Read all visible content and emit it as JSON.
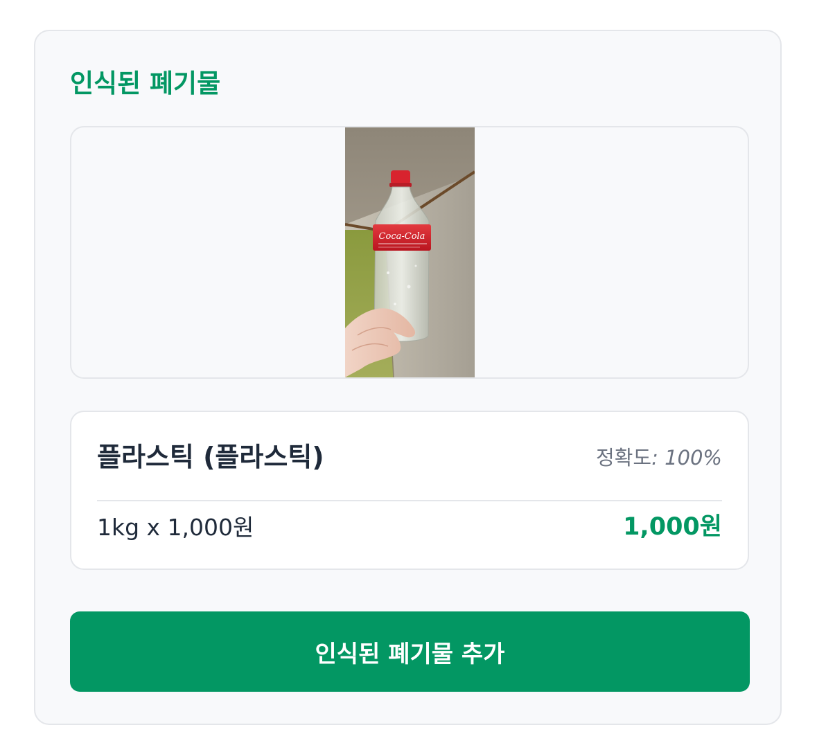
{
  "card": {
    "title": "인식된 폐기물"
  },
  "image": {
    "subject": "Coca-Cola plastic bottle held in hand",
    "bottle_label_text": "Coca-Cola",
    "colors": {
      "wall": "#8e8678",
      "cap": "#d8232e",
      "label": "#cf1f2b"
    }
  },
  "result": {
    "name": "플라스틱 (플라스틱)",
    "accuracy_label": "정확도",
    "accuracy_value": "100%",
    "calc_text": "1kg x 1,000원",
    "total": "1,000원"
  },
  "actions": {
    "add_label": "인식된 폐기물 추가"
  },
  "colors": {
    "accent": "#039763",
    "text_dark": "#1f2a3a",
    "text_muted": "#6b7280",
    "border": "#e4e6ea",
    "card_bg": "#f8f9fb"
  }
}
